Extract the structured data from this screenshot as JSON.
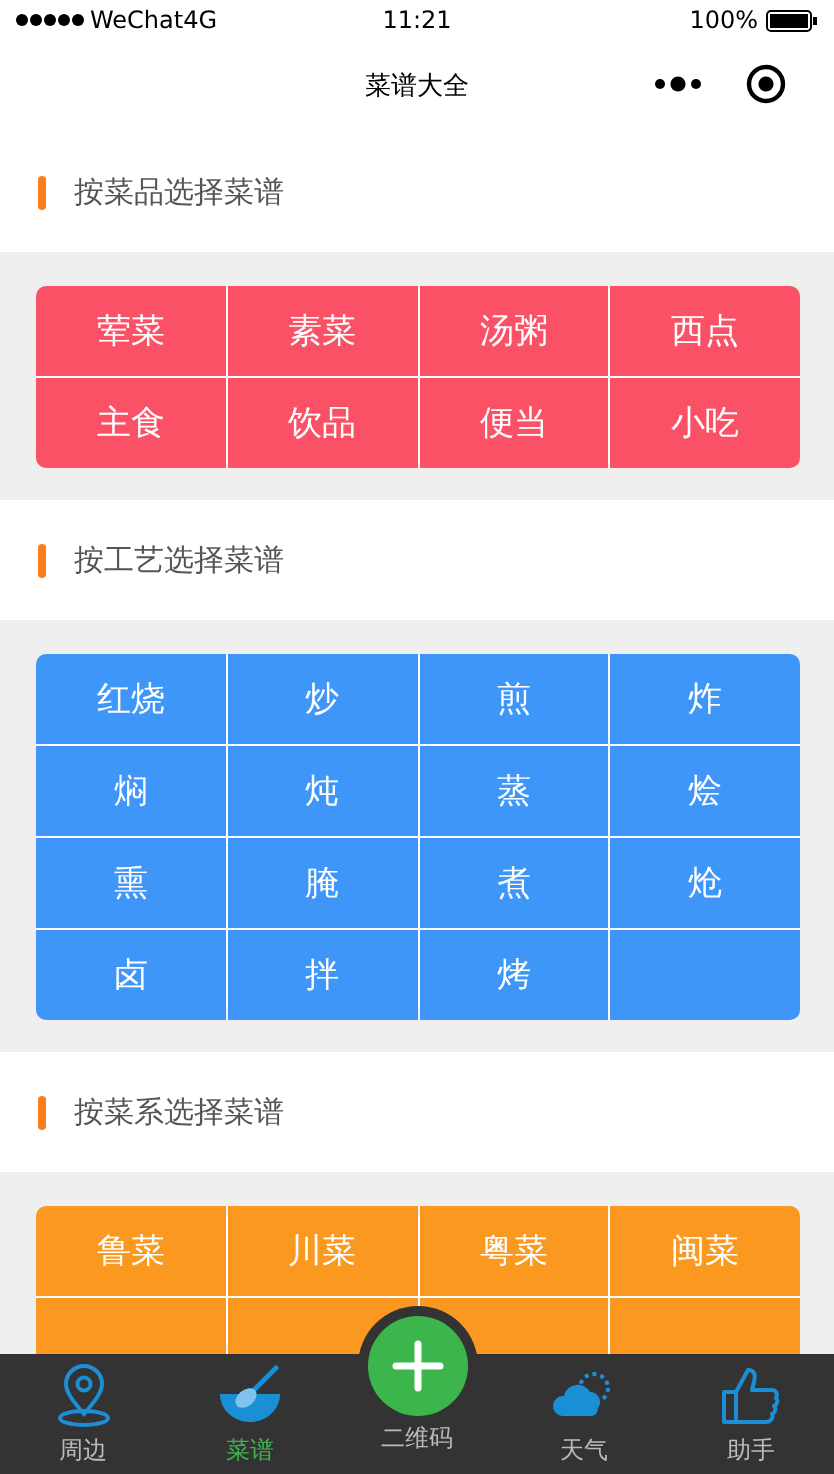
{
  "status_bar": {
    "carrier": "WeChat4G",
    "time": "11:21",
    "battery": "100%"
  },
  "nav_bar": {
    "title": "菜谱大全"
  },
  "sections": [
    {
      "title": "按菜品选择菜谱",
      "color": "#fb5166",
      "items": [
        "荤菜",
        "素菜",
        "汤粥",
        "西点",
        "主食",
        "饮品",
        "便当",
        "小吃"
      ]
    },
    {
      "title": "按工艺选择菜谱",
      "color": "#3d96f8",
      "items": [
        "红烧",
        "炒",
        "煎",
        "炸",
        "焖",
        "炖",
        "蒸",
        "烩",
        "熏",
        "腌",
        "煮",
        "炝",
        "卤",
        "拌",
        "烤"
      ]
    },
    {
      "title": "按菜系选择菜谱",
      "color": "#fa9820",
      "items": [
        "鲁菜",
        "川菜",
        "粤菜",
        "闽菜"
      ]
    }
  ],
  "tab_bar": [
    {
      "kind": "pin",
      "label": "周边",
      "selected": false
    },
    {
      "kind": "bowl",
      "label": "菜谱",
      "selected": true
    },
    {
      "kind": "add",
      "label": "二维码",
      "selected": false
    },
    {
      "kind": "weather",
      "label": "天气",
      "selected": false
    },
    {
      "kind": "thumb",
      "label": "助手",
      "selected": false
    }
  ]
}
